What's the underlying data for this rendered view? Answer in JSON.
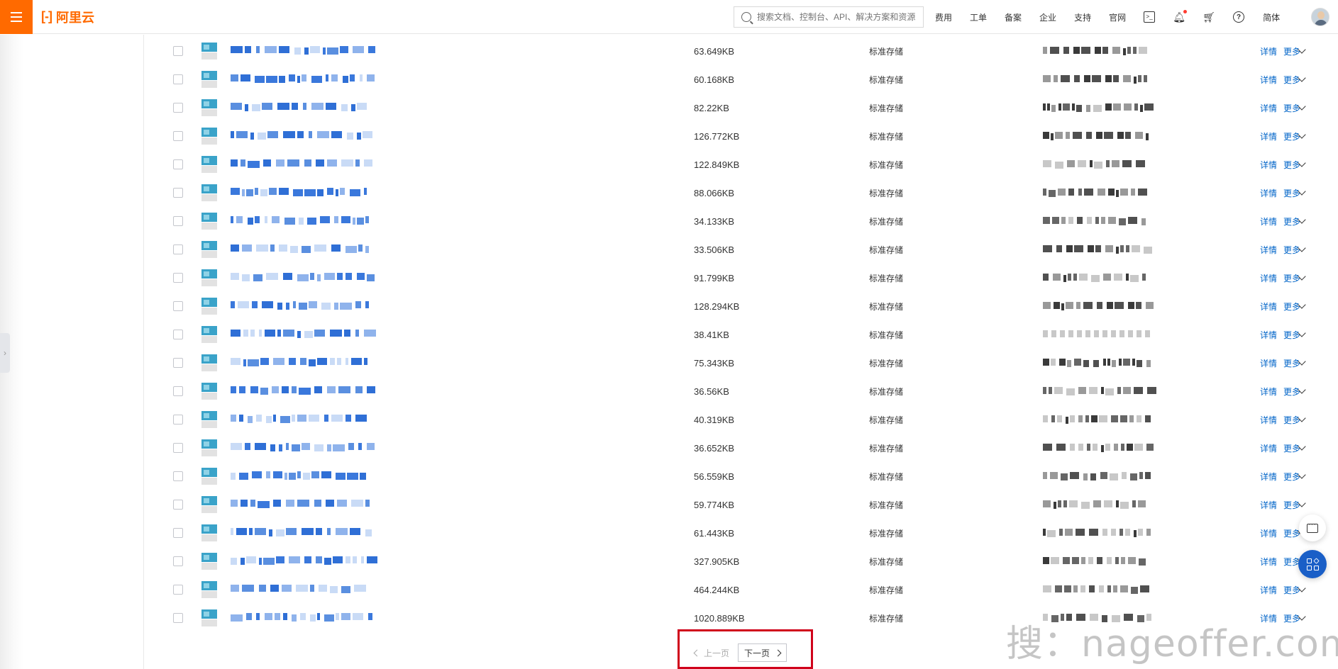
{
  "header": {
    "logo_text": "阿里云",
    "search_placeholder": "搜索文档、控制台、API、解决方案和资源",
    "nav_items": [
      "费用",
      "工单",
      "备案",
      "企业",
      "支持",
      "官网"
    ],
    "language": "简体"
  },
  "table": {
    "storage_class": "标准存储",
    "detail_label": "详情",
    "more_label": "更多",
    "rows": [
      {
        "size": "63.649KB"
      },
      {
        "size": "60.168KB"
      },
      {
        "size": "82.22KB"
      },
      {
        "size": "126.772KB"
      },
      {
        "size": "122.849KB"
      },
      {
        "size": "88.066KB"
      },
      {
        "size": "34.133KB"
      },
      {
        "size": "33.506KB"
      },
      {
        "size": "91.799KB"
      },
      {
        "size": "128.294KB"
      },
      {
        "size": "38.41KB"
      },
      {
        "size": "75.343KB"
      },
      {
        "size": "36.56KB"
      },
      {
        "size": "40.319KB"
      },
      {
        "size": "36.652KB"
      },
      {
        "size": "56.559KB"
      },
      {
        "size": "59.774KB"
      },
      {
        "size": "61.443KB"
      },
      {
        "size": "327.905KB"
      },
      {
        "size": "464.244KB"
      },
      {
        "size": "1020.889KB"
      }
    ]
  },
  "pagination": {
    "prev_label": "上一页",
    "next_label": "下一页"
  },
  "watermark": "搜：nageoffer.com",
  "colors": {
    "brand": "#ff6a00",
    "link": "#0064c8",
    "highlight_border": "#d0021b",
    "float_button": "#1a5fc7"
  }
}
